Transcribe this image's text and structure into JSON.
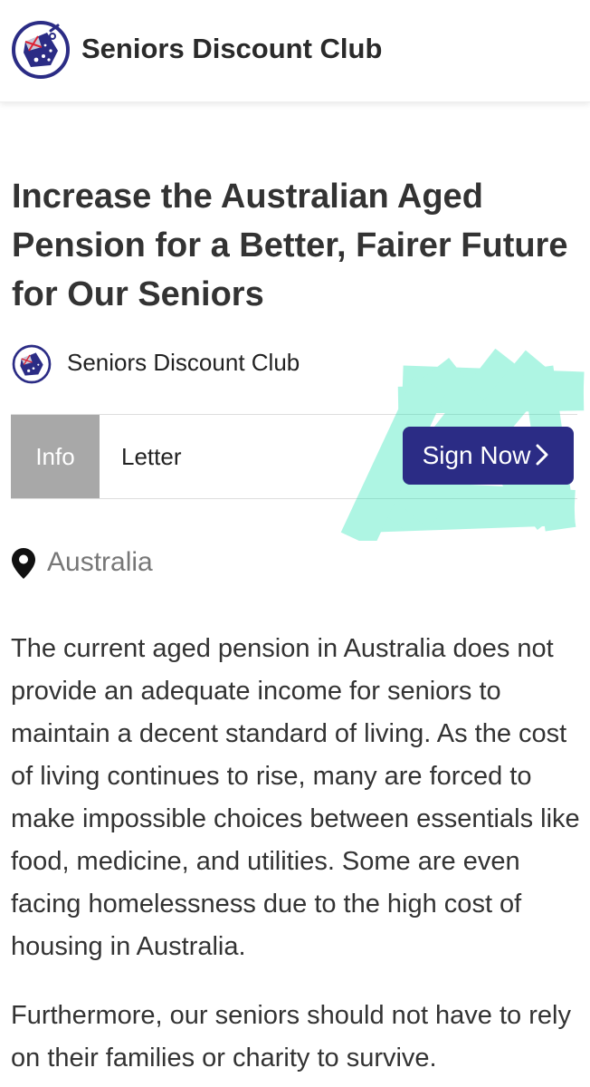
{
  "header": {
    "brand": "Seniors Discount Club",
    "logo_icon": "seniors-discount-club-logo-icon"
  },
  "petition": {
    "title": "Increase the Australian Aged Pension for a Better, Fairer Future for Our Seniors",
    "author": "Seniors Discount Club",
    "location": "Australia",
    "location_icon": "map-pin-icon"
  },
  "tabs": {
    "info": "Info",
    "letter": "Letter"
  },
  "sign_button": {
    "label": "Sign Now",
    "icon": "chevron-right-icon"
  },
  "body": {
    "paragraphs": [
      "The current aged pension in Australia does not provide an adequate income for seniors to maintain a decent standard of living. As the cost of living continues to rise, many are forced to make impossible choices between essentials like food, medicine, and utilities. Some are even facing homelessness due to the high cost of housing in Australia.",
      "Furthermore, our seniors should not have to rely on their families or charity to survive."
    ]
  },
  "colors": {
    "brand_navy": "#2b2c85",
    "tab_active_bg": "#a8a8a8",
    "highlight": "#19e3b0"
  }
}
